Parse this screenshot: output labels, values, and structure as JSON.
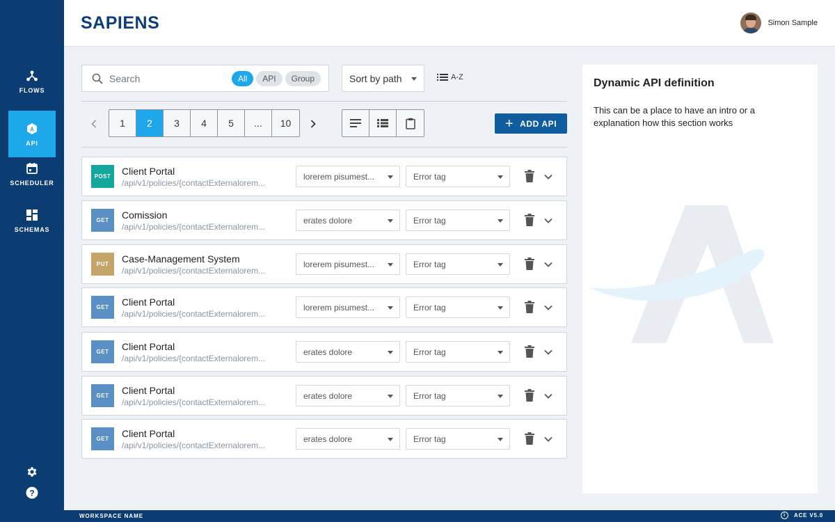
{
  "app": {
    "logo_text": "SAPIENS",
    "brand_color": "#0b3d72",
    "accent_color": "#1ea7ea"
  },
  "user": {
    "name": "Simon Sample"
  },
  "sidebar": {
    "items": [
      {
        "label": "FLOWS",
        "icon": "flows-icon"
      },
      {
        "label": "API",
        "icon": "api-icon",
        "active": true
      },
      {
        "label": "SCHEDULER",
        "icon": "calendar-icon"
      },
      {
        "label": "SCHEMAS",
        "icon": "schemas-icon"
      }
    ],
    "bottom_icons": [
      "settings-icon",
      "help-icon"
    ]
  },
  "search": {
    "placeholder": "Search",
    "chips": [
      {
        "label": "All",
        "active": true
      },
      {
        "label": "API",
        "active": false
      },
      {
        "label": "Group",
        "active": false
      }
    ]
  },
  "sort": {
    "label": "Sort by path",
    "order_label": "A-Z"
  },
  "pagination": {
    "pages": [
      "1",
      "2",
      "3",
      "4",
      "5",
      "...",
      "10"
    ],
    "current": "2"
  },
  "view_toggles": [
    "list-compact-icon",
    "list-detailed-icon",
    "clipboard-icon"
  ],
  "add_button": {
    "label": "ADD API"
  },
  "apis": [
    {
      "method": "POST",
      "method_color": "#14a89c",
      "name": "Client Portal",
      "path": "/api/v1/policies/{contactExternalorem...",
      "dropdown1": "lorerem pisumest...",
      "dropdown2": "Error tag"
    },
    {
      "method": "GET",
      "method_color": "#5b90c4",
      "name": "Comission",
      "path": "/api/v1/policies/{contactExternalorem...",
      "dropdown1": "erates dolore",
      "dropdown2": "Error tag"
    },
    {
      "method": "PUT",
      "method_color": "#c5a46a",
      "name": "Case-Management System",
      "path": "/api/v1/policies/{contactExternalorem...",
      "dropdown1": "lorerem pisumest...",
      "dropdown2": "Error tag"
    },
    {
      "method": "GET",
      "method_color": "#5b90c4",
      "name": "Client Portal",
      "path": "/api/v1/policies/{contactExternalorem...",
      "dropdown1": "lorerem pisumest...",
      "dropdown2": "Error tag"
    },
    {
      "method": "GET",
      "method_color": "#5b90c4",
      "name": "Client Portal",
      "path": "/api/v1/policies/{contactExternalorem...",
      "dropdown1": "erates dolore",
      "dropdown2": "Error tag"
    },
    {
      "method": "GET",
      "method_color": "#5b90c4",
      "name": "Client Portal",
      "path": "/api/v1/policies/{contactExternalorem...",
      "dropdown1": "erates dolore",
      "dropdown2": "Error tag"
    },
    {
      "method": "GET",
      "method_color": "#5b90c4",
      "name": "Client Portal",
      "path": "/api/v1/policies/{contactExternalorem...",
      "dropdown1": "erates dolore",
      "dropdown2": "Error tag"
    }
  ],
  "panel": {
    "title": "Dynamic API definition",
    "text": "This can be a place to have an intro or a explanation how this section works"
  },
  "footer": {
    "workspace": "WORKSPACE NAME",
    "version": "ACE V5.0"
  }
}
